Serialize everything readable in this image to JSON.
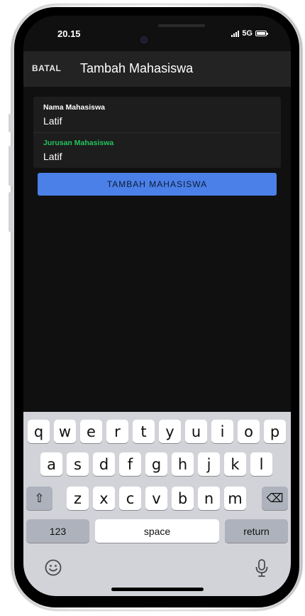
{
  "status_bar": {
    "time": "20.15",
    "network": "5G"
  },
  "app_bar": {
    "cancel_label": "BATAL",
    "title": "Tambah Mahasiswa"
  },
  "form": {
    "fields": [
      {
        "label": "Nama Mahasiswa",
        "value": "Latif",
        "label_color": "#ffffff"
      },
      {
        "label": "Jurusan Mahasiswa",
        "value": "Latif",
        "label_color": "#22c55e"
      }
    ],
    "submit_label": "TAMBAH MAHASISWA"
  },
  "keyboard": {
    "row1": [
      "q",
      "w",
      "e",
      "r",
      "t",
      "y",
      "u",
      "i",
      "o",
      "p"
    ],
    "row2": [
      "a",
      "s",
      "d",
      "f",
      "g",
      "h",
      "j",
      "k",
      "l"
    ],
    "row3": [
      "z",
      "x",
      "c",
      "v",
      "b",
      "n",
      "m"
    ],
    "shift": "⇧",
    "delete": "⌫",
    "numbers": "123",
    "space": "space",
    "return": "return",
    "emoji_icon": "smiley-icon",
    "mic_icon": "microphone-icon"
  },
  "colors": {
    "accent": "#4a80e8",
    "focused_label": "#22c55e",
    "background": "#101010"
  }
}
